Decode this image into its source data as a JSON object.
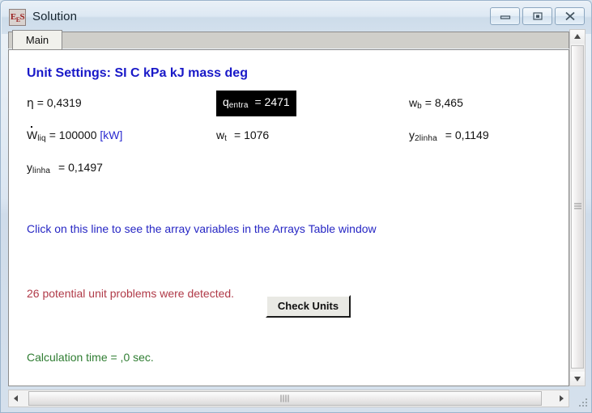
{
  "window": {
    "title": "Solution",
    "app_icon": "ees-icon",
    "icon_text": "EES",
    "controls": {
      "minimize": "minimize-icon",
      "maximize": "maximize-icon",
      "close": "close-icon"
    }
  },
  "tabs": [
    {
      "label": "Main",
      "active": true
    }
  ],
  "content": {
    "unit_settings": "Unit Settings: SI C kPa kJ mass deg",
    "results": [
      {
        "symbol": "η",
        "sub": "",
        "eq": "= 0,4319",
        "unit": "",
        "highlight": false,
        "dot": false,
        "col": 1,
        "row": 1
      },
      {
        "symbol": "W",
        "sub": "liq",
        "eq": "= 100000",
        "unit": "[kW]",
        "highlight": false,
        "dot": true,
        "col": 1,
        "row": 2
      },
      {
        "symbol": "y",
        "sub": "linha",
        "eq": "= 0,1497",
        "unit": "",
        "highlight": false,
        "dot": false,
        "col": 1,
        "row": 3
      },
      {
        "symbol": "q",
        "sub": "entra",
        "eq": "= 2471",
        "unit": "",
        "highlight": true,
        "dot": false,
        "col": 2,
        "row": 1
      },
      {
        "symbol": "w",
        "sub": "t",
        "eq": "= 1076",
        "unit": "",
        "highlight": false,
        "dot": false,
        "col": 2,
        "row": 2
      },
      {
        "symbol": "w",
        "sub": "b",
        "eq": "= 8,465",
        "unit": "",
        "highlight": false,
        "dot": false,
        "col": 3,
        "row": 1
      },
      {
        "symbol": "y",
        "sub": "2linha",
        "eq": "= 0,1149",
        "unit": "",
        "highlight": false,
        "dot": false,
        "col": 3,
        "row": 2
      }
    ],
    "array_link": "Click on this line to see the array variables in the Arrays Table window",
    "unit_problems": "26 potential unit problems were detected.",
    "check_units_button": "Check Units",
    "calculation_time": "Calculation time = ,0 sec."
  },
  "colors": {
    "heading": "#1919c8",
    "link": "#2626c4",
    "warning": "#b03a48",
    "success": "#2f7d32",
    "highlight_bg": "#000000",
    "highlight_fg": "#ffffff",
    "unit": "#2a2ad0"
  }
}
